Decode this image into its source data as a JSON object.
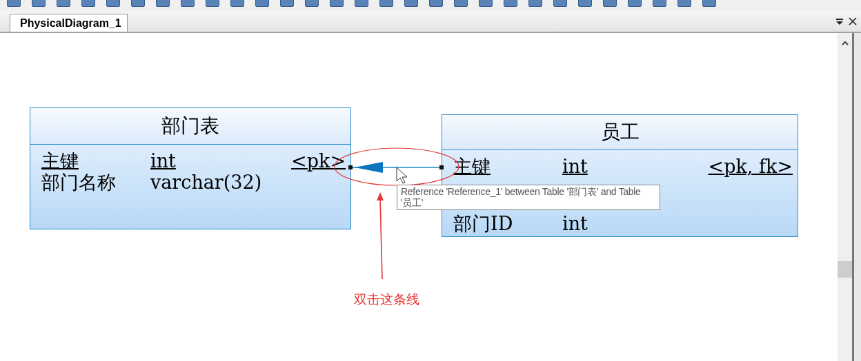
{
  "tab": {
    "label": "PhysicalDiagram_1",
    "selected": true
  },
  "tables": [
    {
      "name": "部门表",
      "columns": [
        {
          "name": "主键",
          "type": "int",
          "key": "<pk>",
          "primary": true
        },
        {
          "name": "部门名称",
          "type": "varchar(32)",
          "primary": false
        }
      ]
    },
    {
      "name": "员工",
      "columns": [
        {
          "name": "主键",
          "type": "int",
          "key": "<pk, fk>",
          "primary": true
        },
        {
          "name": "部门ID",
          "type": "int",
          "primary": false
        }
      ]
    }
  ],
  "tooltip": "Reference 'Reference_1' between Table '部门表' and Table '员工'",
  "annotation": "双击这条线"
}
